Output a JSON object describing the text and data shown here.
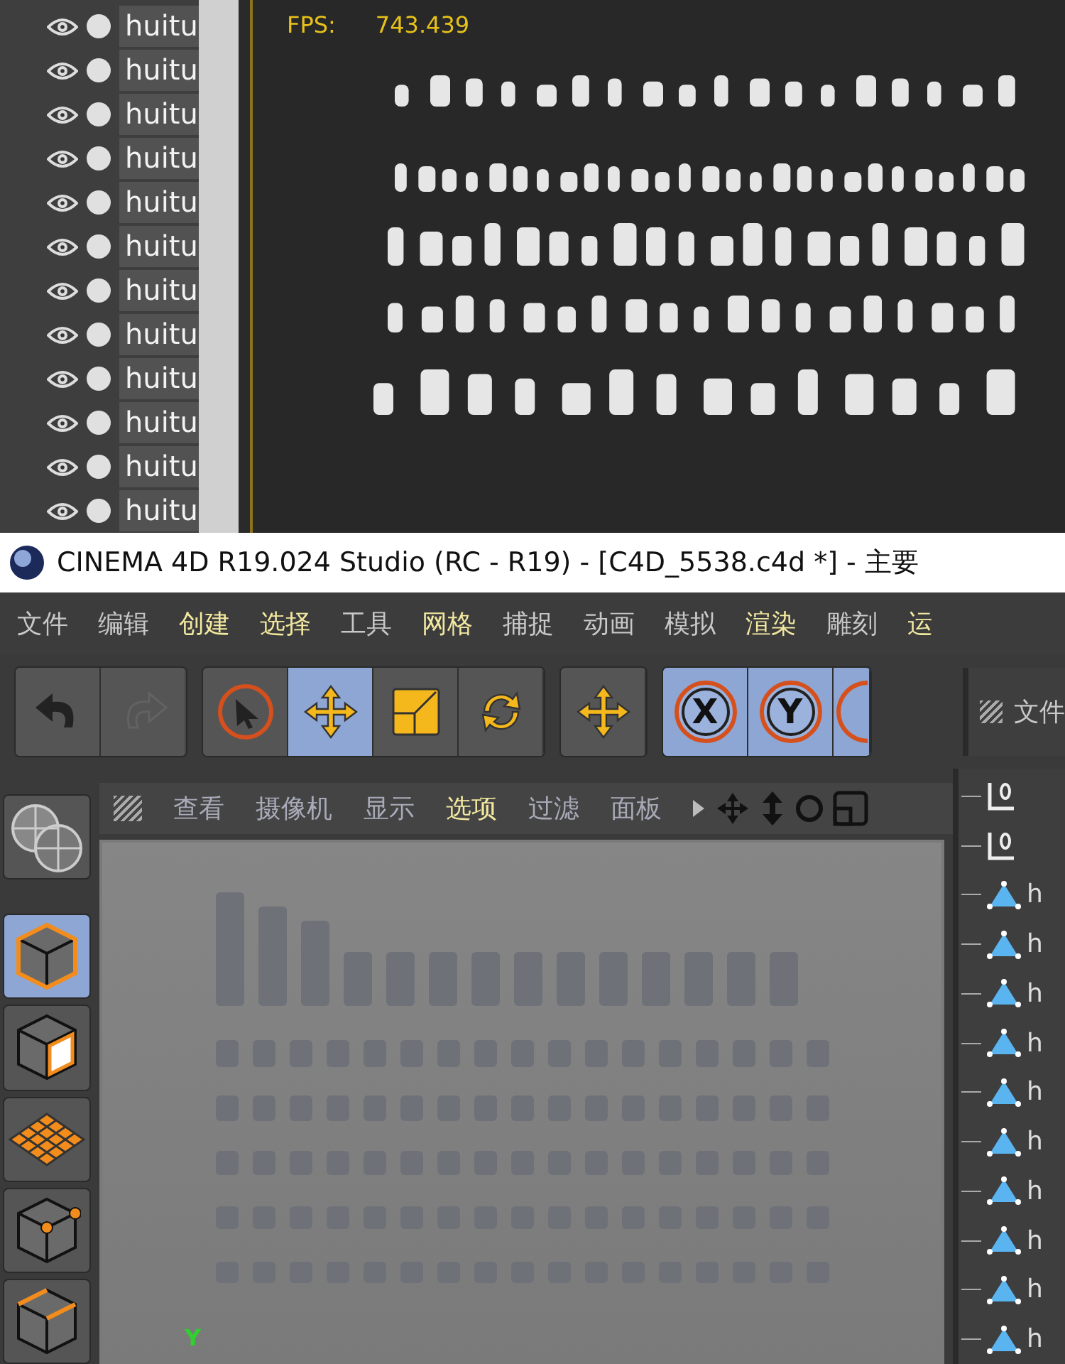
{
  "object_list": {
    "rows": [
      {
        "name": "huitu"
      },
      {
        "name": "huitu"
      },
      {
        "name": "huitu"
      },
      {
        "name": "huitu"
      },
      {
        "name": "huitu"
      },
      {
        "name": "huitu"
      },
      {
        "name": "huitu"
      },
      {
        "name": "huitu"
      },
      {
        "name": "huitu"
      },
      {
        "name": "huitu"
      },
      {
        "name": "huitu"
      },
      {
        "name": "huitu"
      }
    ]
  },
  "preview": {
    "fps_label": "FPS:",
    "fps_value": "743.439"
  },
  "window": {
    "title": "CINEMA 4D R19.024 Studio (RC - R19) - [C4D_5538.c4d *] - 主要"
  },
  "menu": [
    {
      "label": "文件",
      "highlighted": false
    },
    {
      "label": "编辑",
      "highlighted": false
    },
    {
      "label": "创建",
      "highlighted": true
    },
    {
      "label": "选择",
      "highlighted": true
    },
    {
      "label": "工具",
      "highlighted": false
    },
    {
      "label": "网格",
      "highlighted": true
    },
    {
      "label": "捕捉",
      "highlighted": false
    },
    {
      "label": "动画",
      "highlighted": false
    },
    {
      "label": "模拟",
      "highlighted": false
    },
    {
      "label": "渲染",
      "highlighted": true
    },
    {
      "label": "雕刻",
      "highlighted": false
    },
    {
      "label": "运",
      "highlighted": true
    }
  ],
  "toolbar": {
    "groups": [
      [
        {
          "kind": "undo",
          "selected": false,
          "disabled": false
        },
        {
          "kind": "redo",
          "selected": false,
          "disabled": true
        }
      ],
      [
        {
          "kind": "select",
          "selected": false,
          "disabled": false
        },
        {
          "kind": "move",
          "selected": true,
          "disabled": false
        },
        {
          "kind": "scale",
          "selected": false,
          "disabled": false
        },
        {
          "kind": "rotate",
          "selected": false,
          "disabled": false
        }
      ],
      [
        {
          "kind": "move",
          "selected": false,
          "disabled": false
        }
      ],
      [
        {
          "kind": "axis",
          "label": "X",
          "selected": true,
          "disabled": false
        },
        {
          "kind": "axis",
          "label": "Y",
          "selected": true,
          "disabled": false
        },
        {
          "kind": "axis_cut",
          "selected": true,
          "disabled": false
        }
      ]
    ]
  },
  "mode_bar": [
    {
      "kind": "globe",
      "selected": false
    },
    {
      "kind": "model",
      "selected": true
    },
    {
      "kind": "texture",
      "selected": false
    },
    {
      "kind": "polygon",
      "selected": false
    },
    {
      "kind": "point",
      "selected": false
    },
    {
      "kind": "edge",
      "selected": false
    }
  ],
  "viewport": {
    "menu": [
      {
        "label": "查看",
        "highlighted": false
      },
      {
        "label": "摄像机",
        "highlighted": false
      },
      {
        "label": "显示",
        "highlighted": false
      },
      {
        "label": "选项",
        "highlighted": true
      },
      {
        "label": "过滤",
        "highlighted": false
      },
      {
        "label": "面板",
        "highlighted": false
      }
    ],
    "axis_label": "Y"
  },
  "objects_panel": {
    "tab": "文件",
    "rows": [
      {
        "kind": "null"
      },
      {
        "kind": "null"
      },
      {
        "kind": "mesh",
        "name": "h"
      },
      {
        "kind": "mesh",
        "name": "h"
      },
      {
        "kind": "mesh",
        "name": "h"
      },
      {
        "kind": "mesh",
        "name": "h"
      },
      {
        "kind": "mesh",
        "name": "h"
      },
      {
        "kind": "mesh",
        "name": "h"
      },
      {
        "kind": "mesh",
        "name": "h"
      },
      {
        "kind": "mesh",
        "name": "h"
      },
      {
        "kind": "mesh",
        "name": "h"
      },
      {
        "kind": "mesh",
        "name": "h"
      }
    ]
  }
}
